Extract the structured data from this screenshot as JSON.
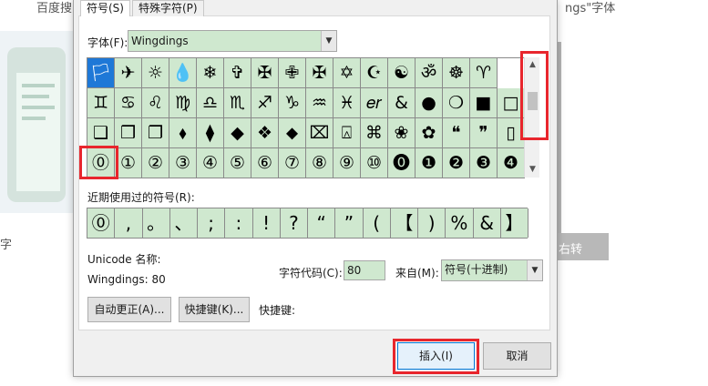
{
  "background": {
    "top_left_text": "百度搜",
    "top_right_text": "ngs\"字体",
    "side_char": "字",
    "right_overlay_text": "右转"
  },
  "tabs": [
    {
      "label": "符号(S)"
    },
    {
      "label": "特殊字符(P)"
    }
  ],
  "font": {
    "label": "字体(F):",
    "value": "Wingdings"
  },
  "symbol_rows": [
    [
      "🏳",
      "✈",
      "☼",
      "💧",
      "❄",
      "✞",
      "✠",
      "✙",
      "✠",
      "✡",
      "☪",
      "☯",
      "ॐ",
      "☸",
      "♈"
    ],
    [
      "♊",
      "♋",
      "♌",
      "♍",
      "♎",
      "♏",
      "♐",
      "♑",
      "♒",
      "♓",
      "𝑒𝑟",
      "&",
      "●",
      "❍",
      "■",
      "□"
    ],
    [
      "❑",
      "❒",
      "❐",
      "⬧",
      "⧫",
      "◆",
      "❖",
      "⬥",
      "⌧",
      "⍓",
      "⌘",
      "❀",
      "✿",
      "❝",
      "❞",
      "▯"
    ],
    [
      "⓪",
      "①",
      "②",
      "③",
      "④",
      "⑤",
      "⑥",
      "⑦",
      "⑧",
      "⑨",
      "⑩",
      "⓿",
      "❶",
      "❷",
      "❸",
      "❹"
    ]
  ],
  "recent": {
    "label": "近期使用过的符号(R):",
    "symbols": [
      "⓪",
      ",",
      "。",
      "、",
      ";",
      ":",
      "!",
      "?",
      "“",
      "”",
      "(",
      "【",
      ")",
      "%",
      "&",
      "】"
    ]
  },
  "unicode_name_label": "Unicode 名称:",
  "char_info": "Wingdings: 80",
  "char_code": {
    "label": "字符代码(C):",
    "value": "80"
  },
  "from": {
    "label": "来自(M):",
    "value": "符号(十进制)"
  },
  "buttons": {
    "autocorrect": "自动更正(A)...",
    "shortcut_key": "快捷键(K)...",
    "shortcut_label": "快捷键:",
    "insert": "插入(I)",
    "cancel": "取消"
  },
  "colors": {
    "cell_bg": "#cfe8cf",
    "selected_bg": "#1e78d7",
    "highlight": "#e8262d"
  }
}
